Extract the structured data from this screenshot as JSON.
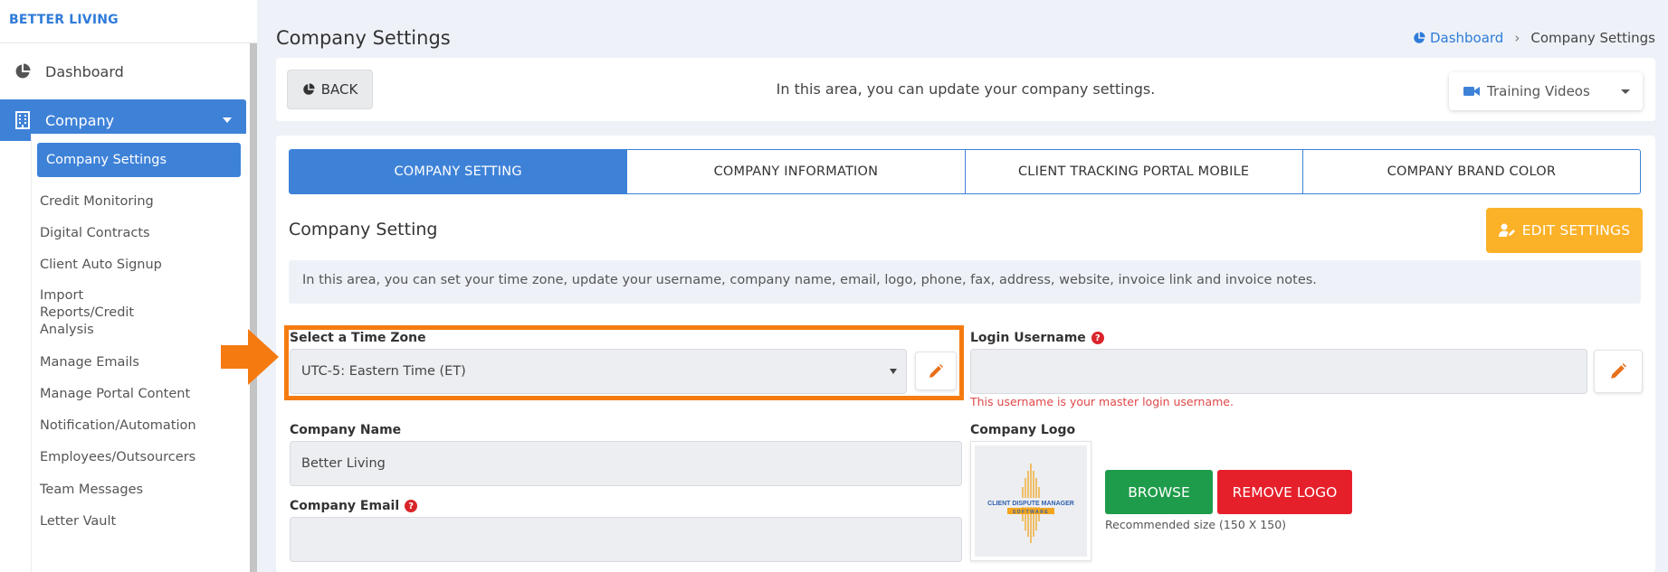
{
  "brand": "BETTER LIVING",
  "sidebar": {
    "dashboard_label": "Dashboard",
    "company_label": "Company",
    "sub_items": [
      "Company Settings",
      "Credit Monitoring",
      "Digital Contracts",
      "Client Auto Signup",
      "Import Reports/Credit Analysis",
      "Manage Emails",
      "Manage Portal Content",
      "Notification/Automation",
      "Employees/Outsourcers",
      "Team Messages",
      "Letter Vault"
    ]
  },
  "page": {
    "title": "Company Settings",
    "breadcrumb": {
      "home": "Dashboard",
      "current": "Company Settings"
    }
  },
  "topbar": {
    "back_label": "BACK",
    "message": "In this area, you can update your company settings.",
    "training_label": "Training Videos"
  },
  "tabs": [
    "COMPANY SETTING",
    "COMPANY INFORMATION",
    "CLIENT TRACKING PORTAL MOBILE",
    "COMPANY BRAND COLOR"
  ],
  "section": {
    "title": "Company Setting",
    "edit_label": "EDIT SETTINGS",
    "info": "In this area, you can set your time zone, update your username, company name, email, logo, phone, fax, address, website, invoice link and invoice notes."
  },
  "form": {
    "timezone_label": "Select a Time Zone",
    "timezone_value": "UTC-5: Eastern Time (ET)",
    "username_label": "Login Username",
    "username_value": "",
    "username_hint": "This username is your master login username.",
    "company_name_label": "Company Name",
    "company_name_value": "Better Living",
    "company_email_label": "Company Email",
    "company_email_value": "",
    "company_logo_label": "Company Logo",
    "browse_label": "BROWSE",
    "remove_logo_label": "REMOVE LOGO",
    "logo_size_hint": "Recommended size (150 X 150)"
  },
  "logo": {
    "line1": "CLIENT DISPUTE MANAGER",
    "line2": "SOFTWARE"
  },
  "colors": {
    "primary": "#3e82d8",
    "warning": "#fbb128",
    "success": "#1e9c4b",
    "danger": "#e6202b",
    "highlight": "#f57b11"
  }
}
